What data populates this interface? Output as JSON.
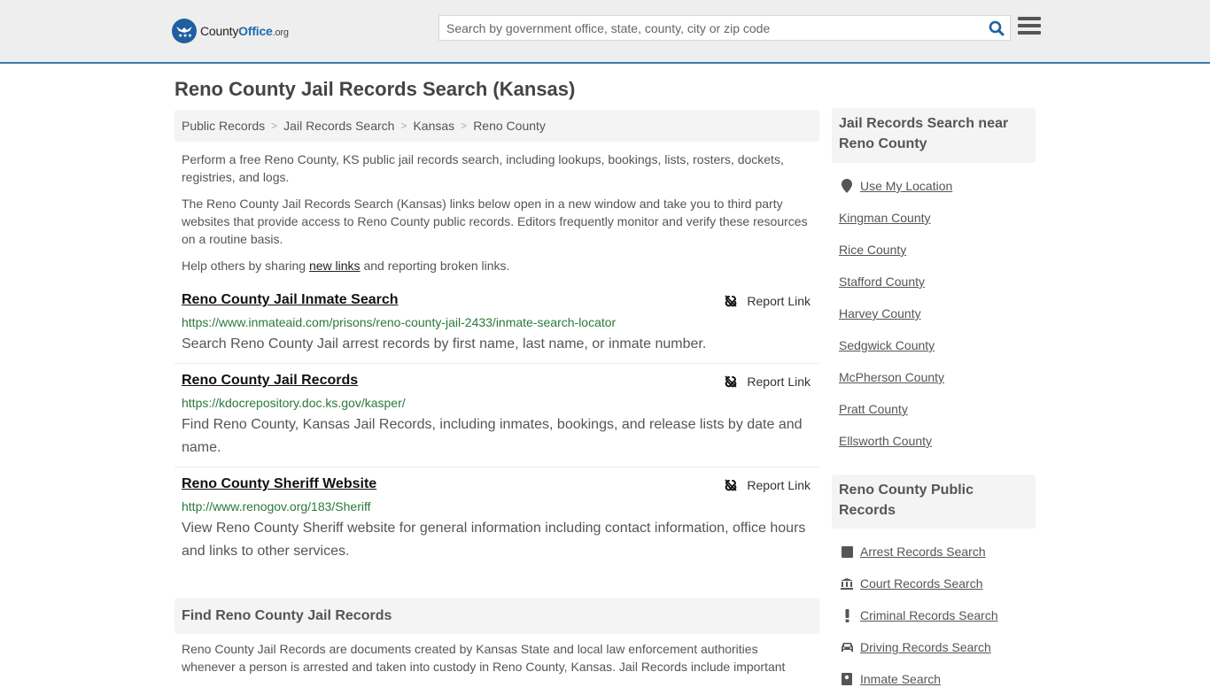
{
  "header": {
    "logo": {
      "name_part1": "County",
      "name_part2": "Office",
      "tld": ".org"
    },
    "search": {
      "placeholder": "Search by government office, state, county, city or zip code",
      "value": ""
    },
    "colors": {
      "brand": "#1f5fa0",
      "header_bg": "#eeeeee",
      "header_border": "#3a7cad"
    }
  },
  "page": {
    "title": "Reno County Jail Records Search (Kansas)",
    "breadcrumb": [
      {
        "label": "Public Records"
      },
      {
        "label": "Jail Records Search"
      },
      {
        "label": "Kansas"
      },
      {
        "label": "Reno County"
      }
    ],
    "intro": {
      "p1": "Perform a free Reno County, KS public jail records search, including lookups, bookings, lists, rosters, dockets, registries, and logs.",
      "p2": "The Reno County Jail Records Search (Kansas) links below open in a new window and take you to third party websites that provide access to Reno County public records. Editors frequently monitor and verify these resources on a routine basis.",
      "p3_before": "Help others by sharing ",
      "p3_link": "new links",
      "p3_after": " and reporting broken links."
    },
    "results": [
      {
        "title": "Reno County Jail Inmate Search",
        "url": "https://www.inmateaid.com/prisons/reno-county-jail-2433/inmate-search-locator",
        "description": "Search Reno County Jail arrest records by first name, last name, or inmate number.",
        "report_label": "Report Link"
      },
      {
        "title": "Reno County Jail Records",
        "url": "https://kdocrepository.doc.ks.gov/kasper/",
        "description": "Find Reno County, Kansas Jail Records, including inmates, bookings, and release lists by date and name.",
        "report_label": "Report Link"
      },
      {
        "title": "Reno County Sheriff Website",
        "url": "http://www.renogov.org/183/Sheriff",
        "description": "View Reno County Sheriff website for general information including contact information, office hours and links to other services.",
        "report_label": "Report Link"
      }
    ],
    "find_section": {
      "heading": "Find Reno County Jail Records",
      "text": "Reno County Jail Records are documents created by Kansas State and local law enforcement authorities whenever a person is arrested and taken into custody in Reno County, Kansas. Jail Records include important"
    }
  },
  "sidebar": {
    "nearby": {
      "heading": "Jail Records Search near Reno County",
      "use_location": "Use My Location",
      "counties": [
        "Kingman County",
        "Rice County",
        "Stafford County",
        "Harvey County",
        "Sedgwick County",
        "McPherson County",
        "Pratt County",
        "Ellsworth County"
      ]
    },
    "public_records": {
      "heading": "Reno County Public Records",
      "items": [
        {
          "label": "Arrest Records Search",
          "icon": "square-icon"
        },
        {
          "label": "Court Records Search",
          "icon": "courthouse-icon"
        },
        {
          "label": "Criminal Records Search",
          "icon": "exclamation-icon"
        },
        {
          "label": "Driving Records Search",
          "icon": "car-icon"
        },
        {
          "label": "Inmate Search",
          "icon": "inmate-icon"
        }
      ]
    }
  }
}
